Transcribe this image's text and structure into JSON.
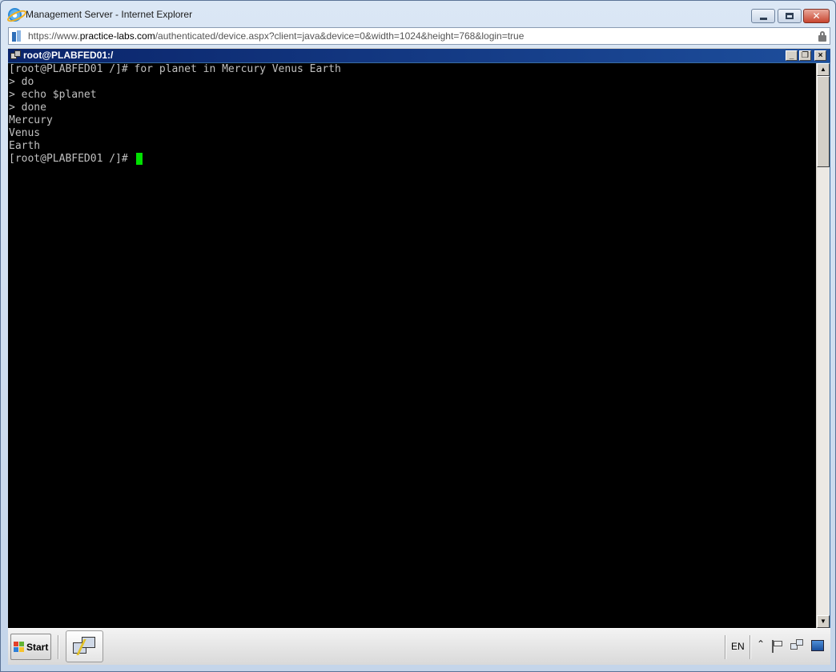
{
  "browser": {
    "title": "Management Server - Internet Explorer",
    "url_prefix": "https://www.",
    "url_domain": "practice-labs.com",
    "url_path": "/authenticated/device.aspx?client=java&device=0&width=1024&height=768&login=true"
  },
  "terminal_window": {
    "title": "root@PLABFED01:/",
    "buttons": {
      "minimize": "_",
      "restore": "❐",
      "close": "×"
    },
    "lines": [
      "[root@PLABFED01 /]# for planet in Mercury Venus Earth",
      "> do",
      "> echo $planet",
      "> done",
      "Mercury",
      "Venus",
      "Earth",
      "[root@PLABFED01 /]# "
    ],
    "cursor_color": "#00e000"
  },
  "taskbar": {
    "start_label": "Start",
    "language": "EN",
    "tray_chevron": "⌃"
  },
  "colors": {
    "terminal_bg": "#000000",
    "terminal_text": "#c0c0c0",
    "title_bar": "#0a246a"
  }
}
